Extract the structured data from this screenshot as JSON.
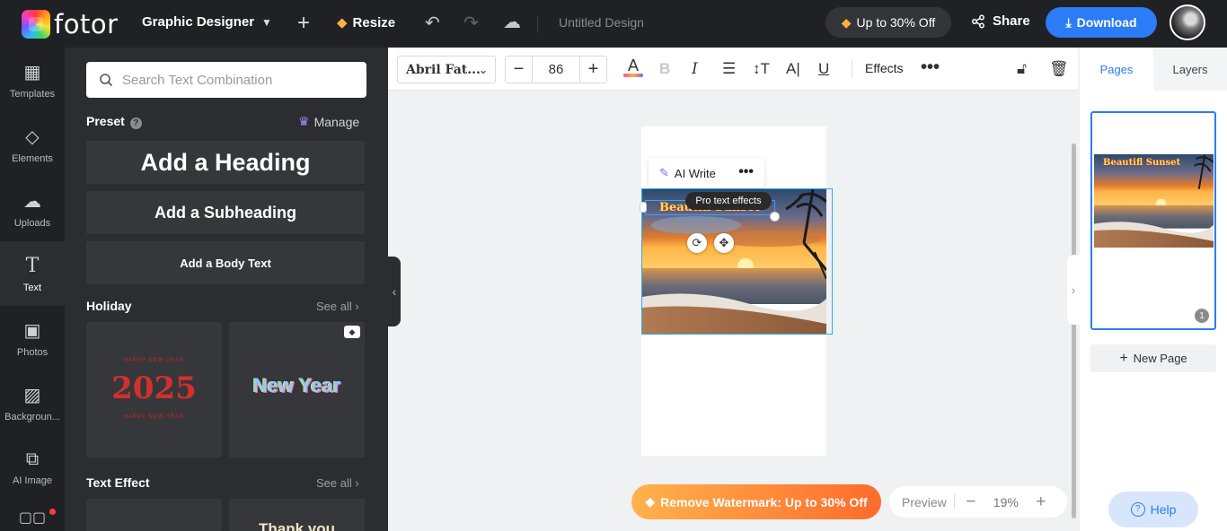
{
  "header": {
    "brand": "fotor",
    "workspace": "Graphic Designer",
    "resize_label": "Resize",
    "doc_title": "Untitled Design",
    "promo_label": "Up to 30% Off",
    "share_label": "Share",
    "download_label": "Download"
  },
  "rail": [
    {
      "label": "Templates",
      "icon": "templates-icon"
    },
    {
      "label": "Elements",
      "icon": "elements-icon"
    },
    {
      "label": "Uploads",
      "icon": "uploads-icon"
    },
    {
      "label": "Text",
      "icon": "text-icon"
    },
    {
      "label": "Photos",
      "icon": "photos-icon"
    },
    {
      "label": "Backgroun...",
      "icon": "background-icon"
    },
    {
      "label": "AI Image",
      "icon": "ai-image-icon"
    }
  ],
  "panel": {
    "search_placeholder": "Search Text Combination",
    "preset_title": "Preset",
    "manage_label": "Manage",
    "heading_label": "Add a Heading",
    "subheading_label": "Add a Subheading",
    "body_label": "Add a Body Text",
    "holiday_title": "Holiday",
    "see_all": "See all",
    "thumb_2025": "2025",
    "thumb_ring_text": "HAPPY NEW YEAR",
    "thumb_newyear": "New Year",
    "text_effect_title": "Text Effect",
    "thumb_thankyou": "Thank you"
  },
  "toolbar": {
    "font_name": "Abril Fat...",
    "font_size": "86",
    "bold_glyph": "B",
    "italic_glyph": "I",
    "effects_label": "Effects"
  },
  "canvas": {
    "ai_write_label": "AI Write",
    "tooltip": "Pro text effects",
    "overlay_text": "Beautifl Sunset",
    "watermark_label": "Remove Watermark: Up to 30% Off",
    "preview_label": "Preview",
    "zoom_value": "19%"
  },
  "right_panel": {
    "tab_pages": "Pages",
    "tab_layers": "Layers",
    "thumb_text": "Beautifl Sunset",
    "page_number": "1",
    "new_page_label": "New Page",
    "help_label": "Help"
  },
  "colors": {
    "accent": "#2b7cf6",
    "dark_bg": "#202124",
    "panel_bg": "#2c2d31",
    "watermark_start": "#ffb24d",
    "watermark_end": "#ff6b2b"
  }
}
